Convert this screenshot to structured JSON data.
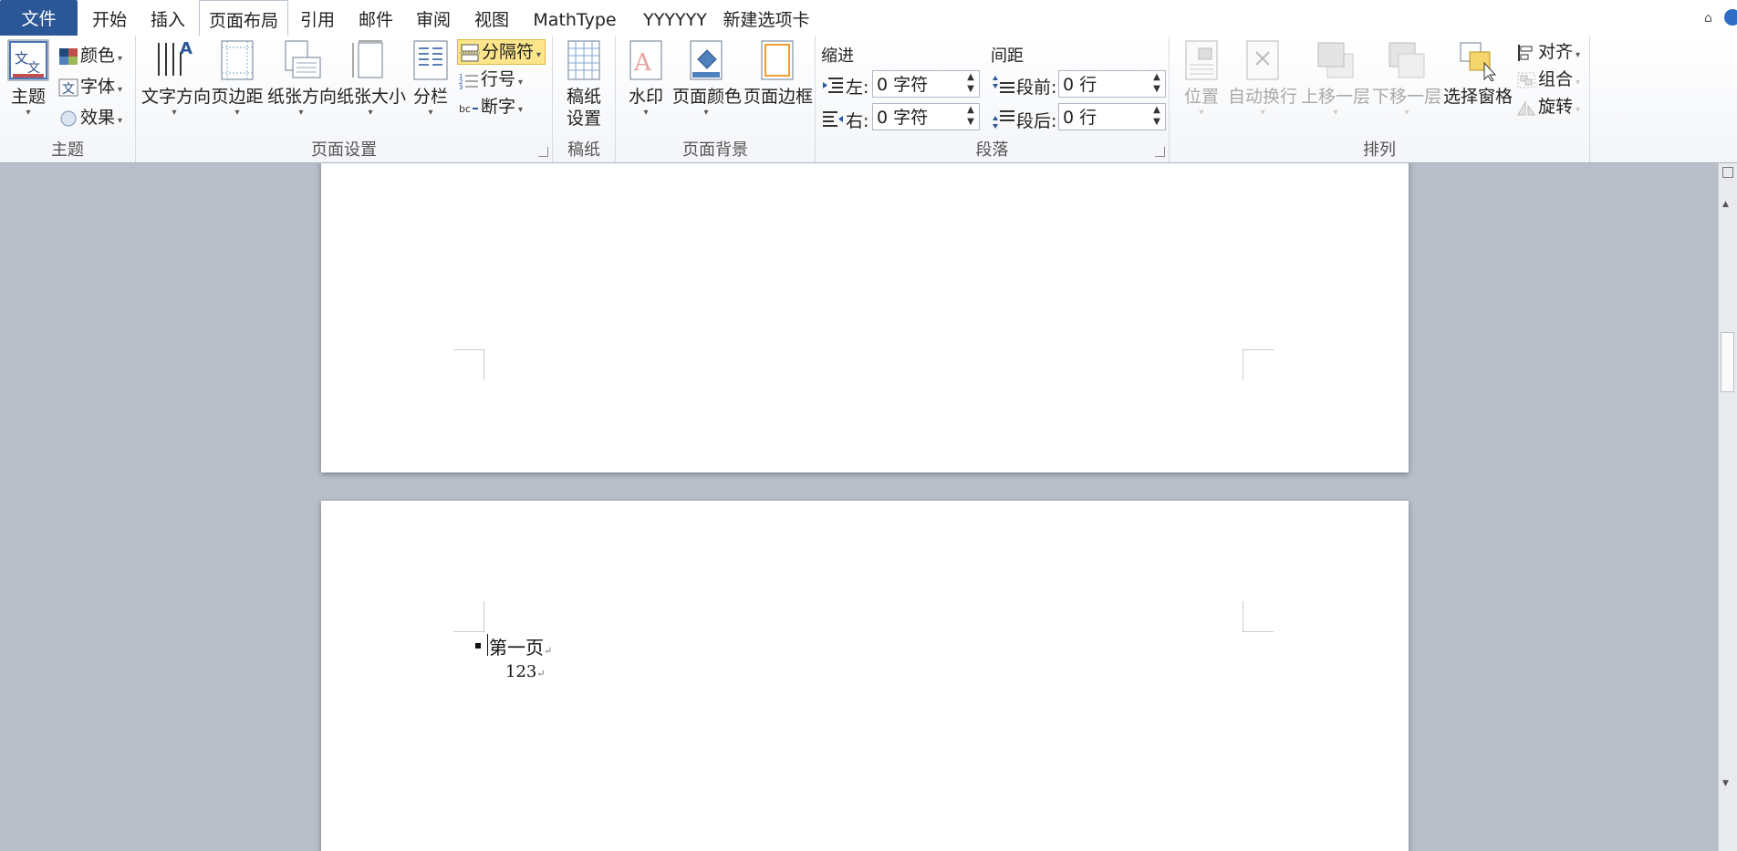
{
  "tabs": {
    "file": "文件",
    "home": "开始",
    "insert": "插入",
    "layout": "页面布局",
    "references": "引用",
    "mailings": "邮件",
    "review": "审阅",
    "view": "视图",
    "mathtype": "MathType",
    "yyyyyy": "YYYYYY",
    "newtab": "新建选项卡"
  },
  "ribbon": {
    "themes": {
      "label": "主题",
      "theme_btn": "主题",
      "colors": "颜色",
      "fonts": "字体",
      "effects": "效果"
    },
    "page_setup": {
      "label": "页面设置",
      "text_direction": "文字方向",
      "margins": "页边距",
      "orientation": "纸张方向",
      "size": "纸张大小",
      "columns": "分栏",
      "breaks": "分隔符",
      "line_numbers": "行号",
      "hyphenation": "断字"
    },
    "manuscript": {
      "label": "稿纸",
      "btn_line1": "稿纸",
      "btn_line2": "设置"
    },
    "page_background": {
      "label": "页面背景",
      "watermark": "水印",
      "page_color": "页面颜色",
      "page_borders": "页面边框"
    },
    "paragraph": {
      "label": "段落",
      "indent_title": "缩进",
      "spacing_title": "间距",
      "left_label": "左:",
      "left_value": "0 字符",
      "right_label": "右:",
      "right_value": "0 字符",
      "before_label": "段前:",
      "before_value": "0 行",
      "after_label": "段后:",
      "after_value": "0 行"
    },
    "arrange": {
      "label": "排列",
      "position": "位置",
      "wrap_text": "自动换行",
      "bring_forward": "上移一层",
      "send_backward": "下移一层",
      "selection_pane": "选择窗格",
      "align": "对齐",
      "group": "组合",
      "rotate": "旋转"
    }
  },
  "document": {
    "line1": "第一页",
    "line2": "123"
  },
  "colors": {
    "file_tab": "#2b5797",
    "breaks_highlight": "#fde58b",
    "workspace": "#b8bfc9"
  }
}
